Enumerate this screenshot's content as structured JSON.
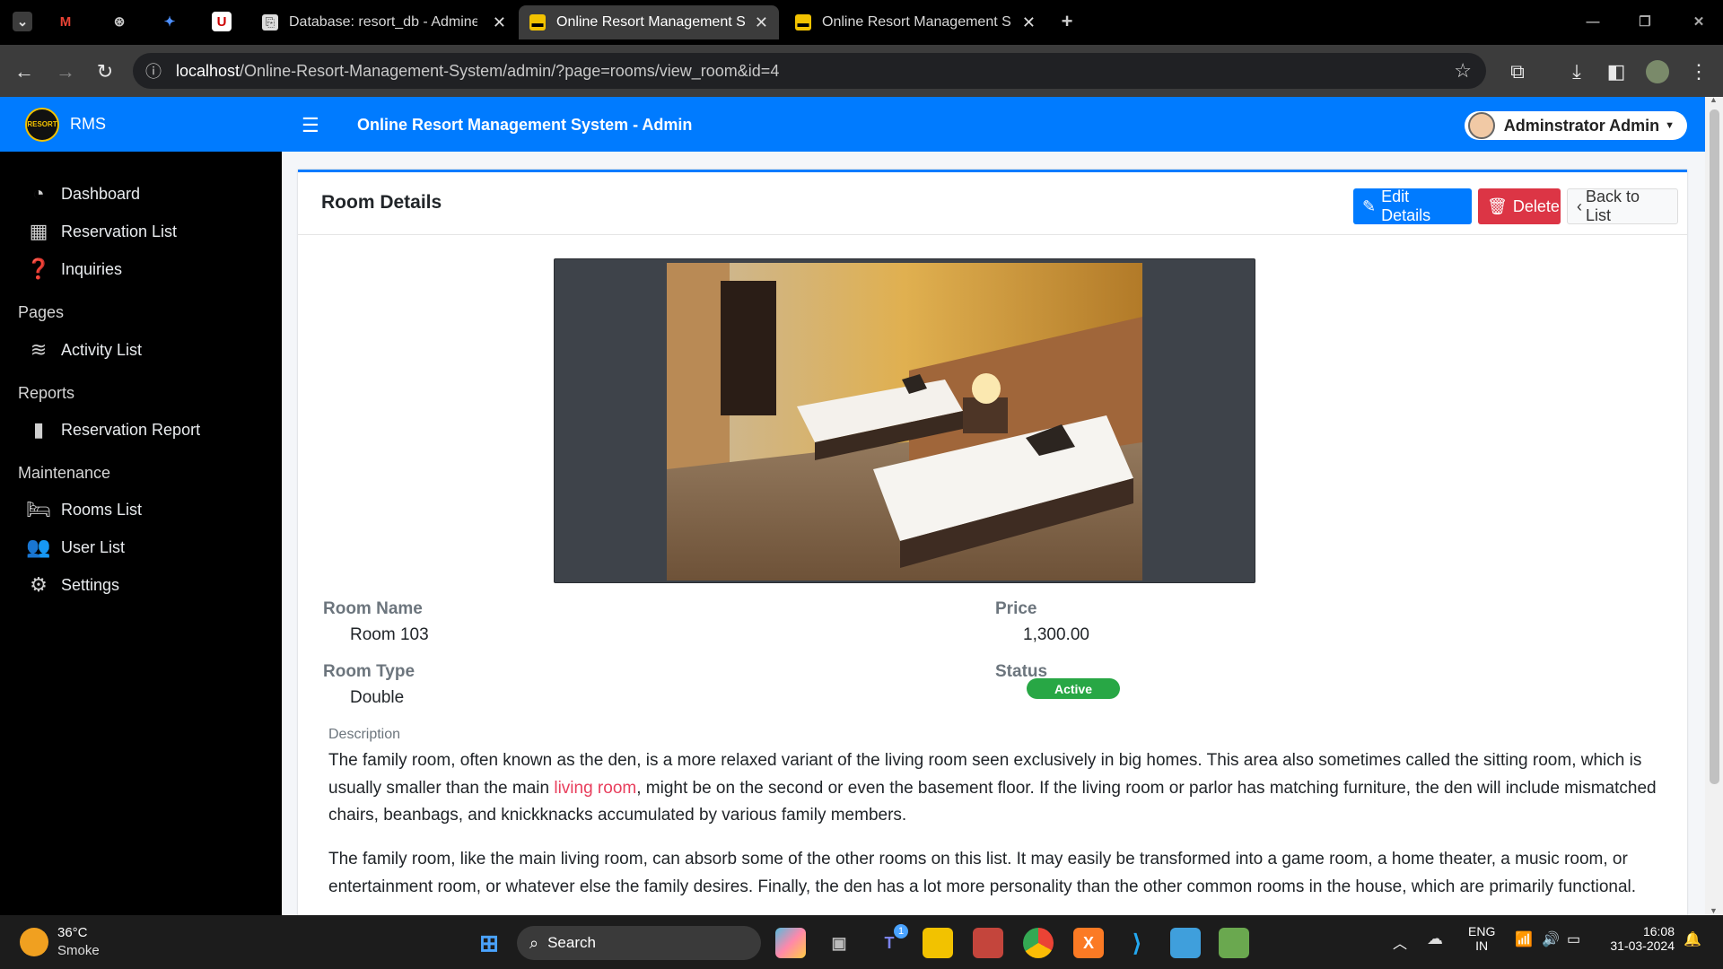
{
  "browser": {
    "tabs": [
      {
        "title": "Database: resort_db - Adminer",
        "active": false
      },
      {
        "title": "Online Resort Management Sys",
        "active": true
      },
      {
        "title": "Online Resort Management Sys",
        "active": false
      }
    ],
    "url_host": "localhost",
    "url_path": "/Online-Resort-Management-System/admin/?page=rooms/view_room&id=4"
  },
  "sidebar": {
    "brand": "RMS",
    "logo_text": "RESORT",
    "items": [
      {
        "label": "Dashboard",
        "icon": "dashboard-icon"
      },
      {
        "label": "Reservation List",
        "icon": "table-icon"
      },
      {
        "label": "Inquiries",
        "icon": "question-icon"
      }
    ],
    "sections": [
      {
        "header": "Pages",
        "items": [
          {
            "label": "Activity List",
            "icon": "swimmer-icon"
          }
        ]
      },
      {
        "header": "Reports",
        "items": [
          {
            "label": "Reservation Report",
            "icon": "file-icon"
          }
        ]
      },
      {
        "header": "Maintenance",
        "items": [
          {
            "label": "Rooms List",
            "icon": "bed-icon"
          },
          {
            "label": "User List",
            "icon": "users-icon"
          },
          {
            "label": "Settings",
            "icon": "cogs-icon"
          }
        ]
      }
    ]
  },
  "topnav": {
    "title": "Online Resort Management System - Admin",
    "user": "Adminstrator Admin"
  },
  "card": {
    "title": "Room Details",
    "edit_label": "Edit Details",
    "delete_label": "Delete",
    "back_label": "Back to List"
  },
  "room": {
    "name_label": "Room Name",
    "name": "Room 103",
    "price_label": "Price",
    "price": "1,300.00",
    "type_label": "Room Type",
    "type": "Double",
    "status_label": "Status",
    "status": "Active",
    "description_label": "Description",
    "p1_a": "The family room, often known as the den, is a more relaxed variant of the living room seen exclusively in big homes. This area also sometimes called the sitting room, which is usually smaller than the main ",
    "p1_link": "living room",
    "p1_b": ", might be on the second or even the basement floor. If the living room or parlor has matching furniture, the den will include mismatched chairs, beanbags, and knickknacks accumulated by various family members.",
    "p2": "The family room, like the main living room, can absorb some of the other rooms on this list. It may easily be transformed into a game room, a home theater, a music room, or entertainment room, or whatever else the family desires. Finally, the den has a lot more personality than the other common rooms in the house, which are primarily functional."
  },
  "taskbar": {
    "weather_temp": "36°C",
    "weather_desc": "Smoke",
    "search": "Search",
    "lang1": "ENG",
    "lang2": "IN",
    "time": "16:08",
    "date": "31-03-2024",
    "badge": "1"
  },
  "colors": {
    "primary": "#007bff",
    "danger": "#dc3545",
    "success": "#28a745",
    "link": "#e83e5c"
  }
}
